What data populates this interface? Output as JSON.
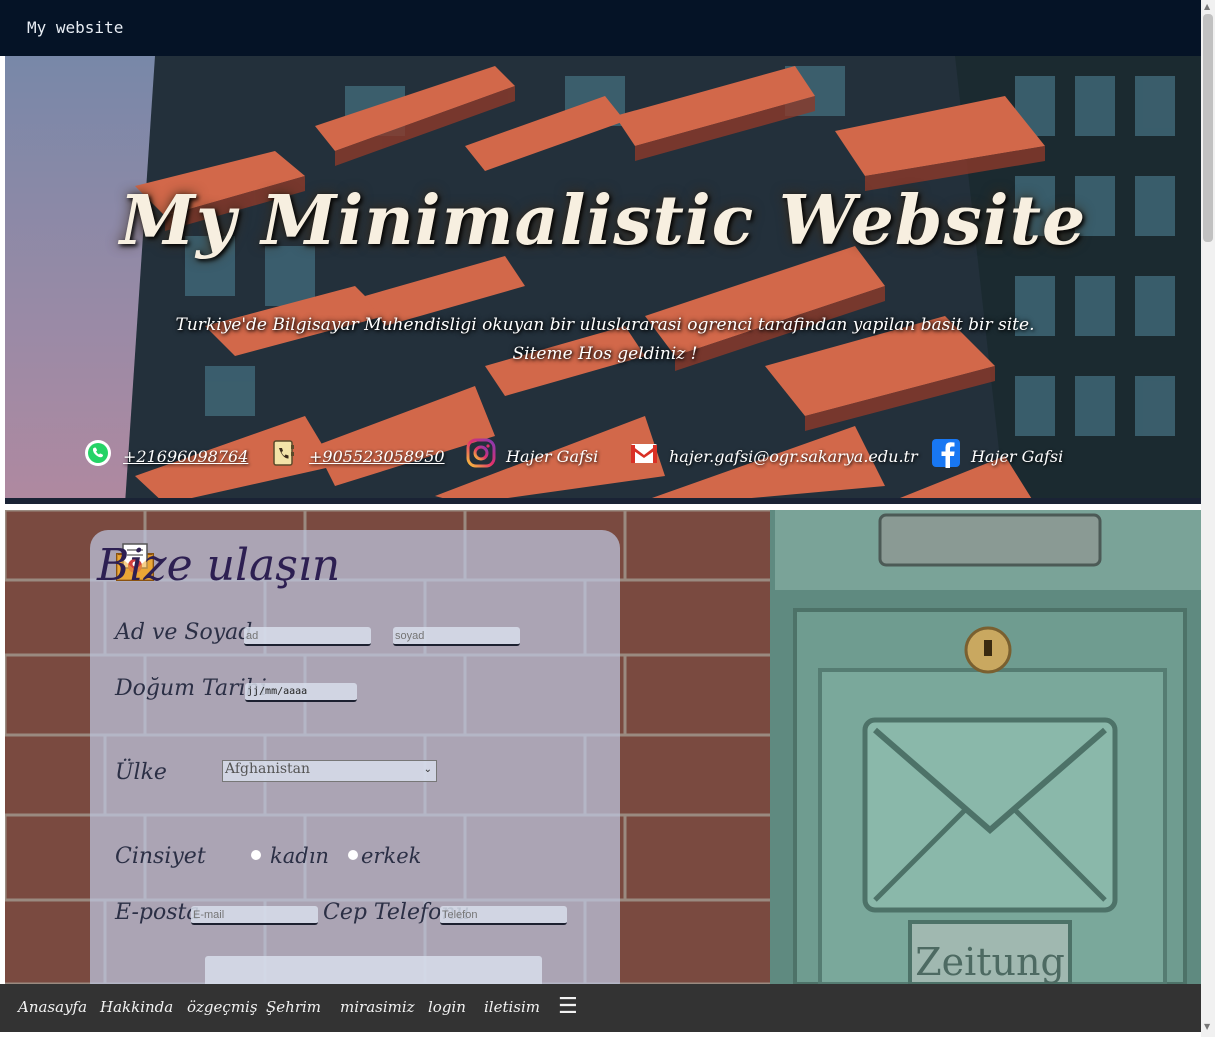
{
  "topbar": {
    "title": "My website"
  },
  "hero": {
    "title": "My Minimalistic Website",
    "subtitle_line1": "Turkiye'de Bilgisayar Muhendisligi okuyan bir uluslararasi ogrenci tarafindan yapilan basit bir site.",
    "subtitle_line2": "Siteme Hos geldiniz !",
    "contacts": [
      {
        "icon": "whatsapp-icon",
        "text": "+21696098764"
      },
      {
        "icon": "phone-book-icon",
        "text": "+905523058950"
      },
      {
        "icon": "instagram-icon",
        "text": "Hajer Gafsi"
      },
      {
        "icon": "gmail-icon",
        "text": "hajer.gafsi@ogr.sakarya.edu.tr"
      },
      {
        "icon": "facebook-icon",
        "text": "Hajer Gafsi"
      }
    ]
  },
  "form": {
    "title": "Bize ulaşın",
    "name_label": "Ad ve Soyad",
    "first_name_placeholder": "ad",
    "last_name_placeholder": "soyad",
    "birth_label": "Doğum Tarihi",
    "birth_placeholder": "jj/mm/aaaa",
    "country_label": "Ülke",
    "country_selected": "Afghanistan",
    "gender_label": "Cinsiyet",
    "gender_female": "kadın",
    "gender_male": "erkek",
    "email_label": "E-posta",
    "email_placeholder": "E-mail",
    "phone_label": "Cep Telefonu",
    "phone_placeholder": "Telefon"
  },
  "nav": {
    "items": [
      "Anasayfa",
      "Hakkinda",
      "özgeçmiş",
      "Şehrim",
      "mirasimiz",
      "login",
      "iletisim"
    ],
    "menu_icon": "hamburger-icon"
  },
  "colors": {
    "topbar": "#051326",
    "nav": "#333333",
    "form_title": "#2d1f52"
  }
}
